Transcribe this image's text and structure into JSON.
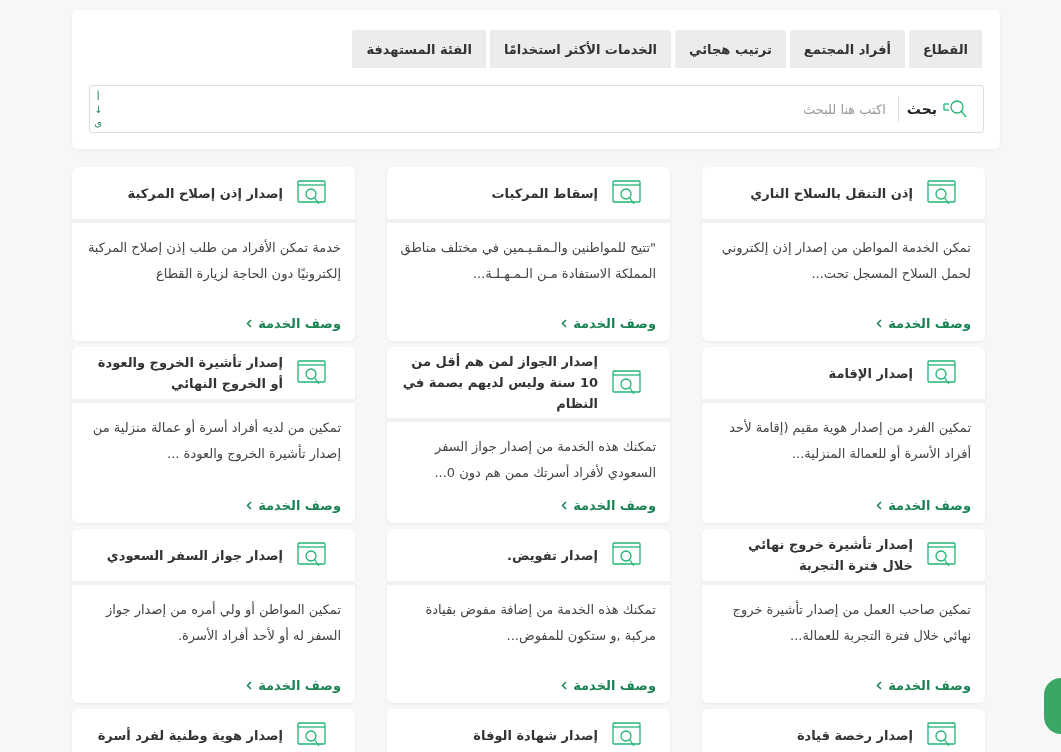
{
  "tabs": [
    {
      "label": "القطاع",
      "selected": false
    },
    {
      "label": "أفراد المجتمع",
      "selected": false
    },
    {
      "label": "ترتيب هجائي",
      "selected": false
    },
    {
      "label": "الخدمات الأكثر استخدامًا",
      "selected": false
    },
    {
      "label": "الفئة المستهدفة",
      "selected": false
    }
  ],
  "search": {
    "label": "بحث",
    "placeholder": "اكتب هنا للبحث",
    "sort_lines": [
      "أ",
      "↓",
      "ى"
    ]
  },
  "services": [
    {
      "title": "إذن التنقل بالسلاح الناري",
      "description": "تمكن الخدمة المواطن من إصدار إذن إلكتروني لحمل السلاح المسجل تحت...",
      "link": "وصف الخدمة"
    },
    {
      "title": "إسقاط المركبات",
      "description": "\"تتيح للمواطنين والـمقـيـمين في مختلف مناطق المملكة الاستفادة مـن الـمـهـلـة...",
      "link": "وصف الخدمة"
    },
    {
      "title": "إصدار إذن إصلاح المركبة",
      "description": "خدمة تمكن الأفراد من طلب إذن إصلاح المركبة إلكترونيًا دون الحاجة لزيارة القطاع",
      "link": "وصف الخدمة"
    },
    {
      "title": "إصدار الإقامة",
      "description": "تمكين الفرد من إصدار هوية مقيم (إقامة لأحد أفراد الأسرة أو للعمالة المنزلية...",
      "link": "وصف الخدمة"
    },
    {
      "title": "إصدار الجواز لمن هم أقل من 10 سنة وليس لديهم بصمة في النظام",
      "description": "تمكنك هذه الخدمة من إصدار جواز السفر السعودي لأفراد أسرتك ممن هم دون 0...",
      "link": "وصف الخدمة"
    },
    {
      "title": "إصدار تأشيرة الخروج والعودة أو الخروج النهائي",
      "description": "تمكين من لديه أفراد أسرة أو عمالة منزلية من إصدار تأشيرة الخروج والعودة ...",
      "link": "وصف الخدمة"
    },
    {
      "title": "إصدار تأشيرة خروج نهائي خلال فترة التجربة",
      "description": "تمكين صاحب العمل من إصدار تأشيرة خروج نهائي خلال فترة التجربة للعمالة...",
      "link": "وصف الخدمة"
    },
    {
      "title": "إصدار تفويض.",
      "description": "تمكنك هذه الخدمة من إضافة مفوض بقيادة مركبة ,و ستكون للمفوض...",
      "link": "وصف الخدمة"
    },
    {
      "title": "إصدار جواز السفر السعودي",
      "description": "تمكين المواطن أو ولي أمره من إصدار جواز السفر له أو لأحد أفراد الأسرة.",
      "link": "وصف الخدمة"
    },
    {
      "title": "إصدار رخصة قيادة"
    },
    {
      "title": "إصدار شهادة الوفاة"
    },
    {
      "title": "إصدار هوية وطنية لفرد أسرة"
    }
  ]
}
